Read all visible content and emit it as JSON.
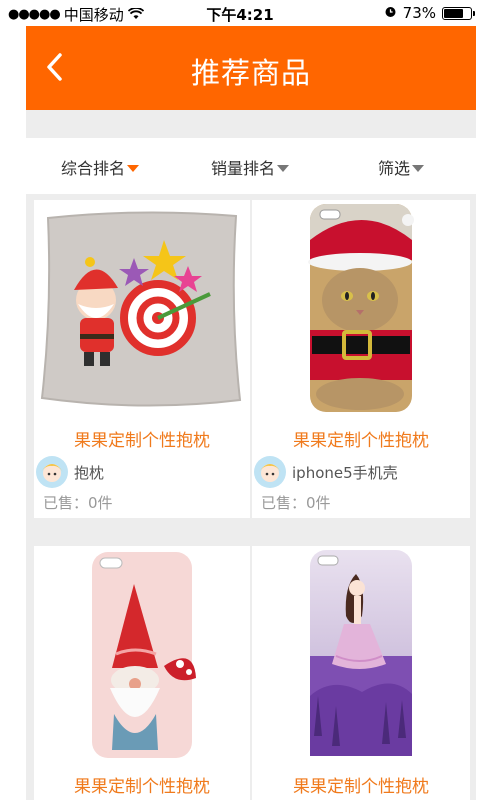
{
  "status_bar": {
    "signal": "●●●●●",
    "carrier": "中国移动",
    "time": "下午4:21",
    "battery_text": "73%",
    "battery_level": 0.73
  },
  "header": {
    "title": "推荐商品"
  },
  "sort_bar": {
    "items": [
      {
        "label": "综合排名",
        "active": true
      },
      {
        "label": "销量排名",
        "active": false
      },
      {
        "label": "筛选",
        "active": false
      }
    ]
  },
  "colors": {
    "accent": "#ff6600",
    "title_orange": "#f07a1c",
    "inactive_arrow": "#777777"
  },
  "products": [
    {
      "title": "果果定制个性抱枕",
      "author": "抱枕",
      "sold": "已售：0件",
      "image": "pillow-santa-image"
    },
    {
      "title": "果果定制个性抱枕",
      "author": "iphone5手机壳",
      "sold": "已售：0件",
      "image": "phone-case-cat-image"
    },
    {
      "title": "果果定制个性抱枕",
      "image": "phone-case-gnome-image"
    },
    {
      "title": "果果定制个性抱枕",
      "image": "phone-case-girl-image"
    }
  ]
}
